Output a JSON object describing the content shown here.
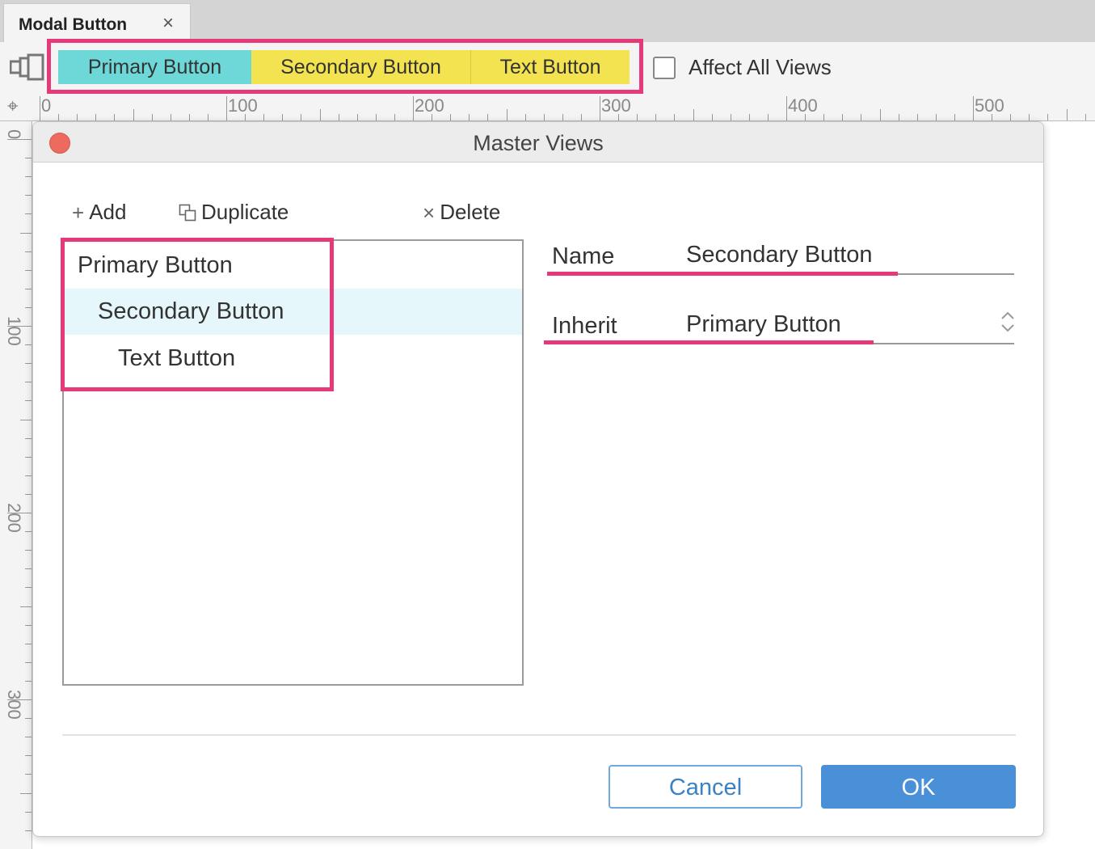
{
  "tab": {
    "title": "Modal Button",
    "close_glyph": "×"
  },
  "toolbar": {
    "view_tabs": [
      "Primary Button",
      "Secondary Button",
      "Text Button"
    ],
    "affect_all_label": "Affect All Views",
    "affect_all_checked": false,
    "icons": [
      "master-views-icon",
      "crosshair-icon"
    ]
  },
  "ruler": {
    "top_labels": [
      "0",
      "100",
      "200",
      "300",
      "400",
      "500"
    ],
    "left_labels": [
      "0",
      "100",
      "200",
      "300"
    ]
  },
  "dialog": {
    "title": "Master Views",
    "actions": {
      "add": "Add",
      "duplicate": "Duplicate",
      "delete": "Delete"
    },
    "list": [
      "Primary Button",
      "Secondary Button",
      "Text Button"
    ],
    "selected_index": 1,
    "fields": {
      "name_label": "Name",
      "name_value": "Secondary Button",
      "inherit_label": "Inherit",
      "inherit_value": "Primary Button"
    },
    "buttons": {
      "cancel": "Cancel",
      "ok": "OK"
    }
  },
  "colors": {
    "highlight": "#e6397a",
    "primary_view": "#6ed8d8",
    "secondary_view": "#f4e350",
    "accent": "#4a90d9",
    "close_dot": "#ec6a5e",
    "selection": "#e5f7fb"
  }
}
